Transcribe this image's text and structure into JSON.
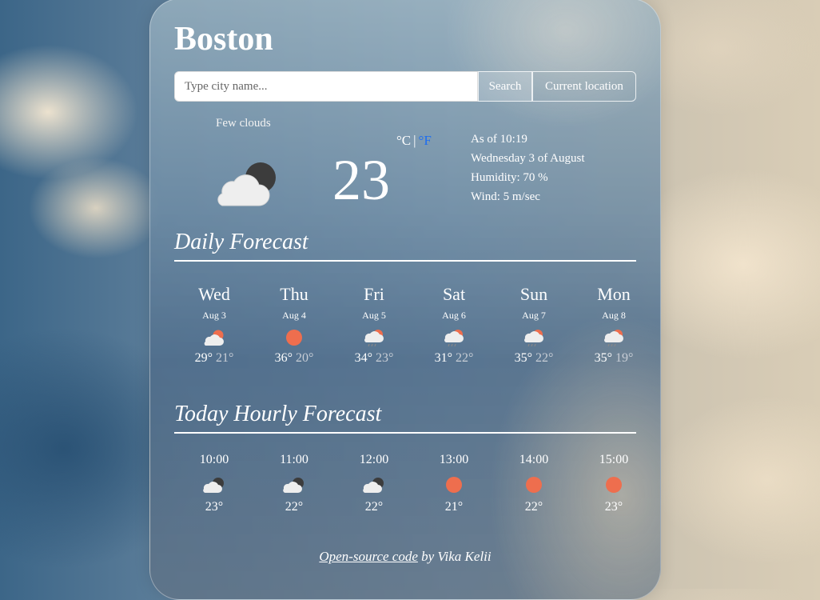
{
  "city": "Boston",
  "search": {
    "placeholder": "Type city name...",
    "search_label": "Search",
    "location_label": "Current location"
  },
  "current": {
    "description": "Few clouds",
    "icon": "few-clouds-night-icon",
    "temperature": "23",
    "unit_c": "°C",
    "unit_sep": "|",
    "unit_f": "°F",
    "as_of": "As of 10:19",
    "date": "Wednesday 3 of August",
    "humidity": "Humidity: 70 %",
    "wind": "Wind: 5 m/sec"
  },
  "daily_title": "Daily Forecast",
  "daily": [
    {
      "day": "Wed",
      "date": "Aug 3",
      "icon": "cloud-sun-icon",
      "high": "29°",
      "low": "21°"
    },
    {
      "day": "Thu",
      "date": "Aug 4",
      "icon": "sun-icon",
      "high": "36°",
      "low": "20°"
    },
    {
      "day": "Fri",
      "date": "Aug 5",
      "icon": "rain-sun-icon",
      "high": "34°",
      "low": "23°"
    },
    {
      "day": "Sat",
      "date": "Aug 6",
      "icon": "rain-sun-icon",
      "high": "31°",
      "low": "22°"
    },
    {
      "day": "Sun",
      "date": "Aug 7",
      "icon": "rain-sun-icon",
      "high": "35°",
      "low": "22°"
    },
    {
      "day": "Mon",
      "date": "Aug 8",
      "icon": "rain-sun-icon",
      "high": "35°",
      "low": "19°"
    }
  ],
  "hourly_title": "Today Hourly Forecast",
  "hourly": [
    {
      "time": "10:00",
      "icon": "cloud-moon-icon",
      "temp": "23°"
    },
    {
      "time": "11:00",
      "icon": "cloud-moon-icon",
      "temp": "22°"
    },
    {
      "time": "12:00",
      "icon": "cloud-moon-icon",
      "temp": "22°"
    },
    {
      "time": "13:00",
      "icon": "sun-icon",
      "temp": "21°"
    },
    {
      "time": "14:00",
      "icon": "sun-icon",
      "temp": "22°"
    },
    {
      "time": "15:00",
      "icon": "sun-icon",
      "temp": "23°"
    }
  ],
  "footer": {
    "link": "Open-source code",
    "by": " by Vika Kelii"
  },
  "colors": {
    "sun": "#ee6e4e",
    "unit_link": "#1e6ef0"
  }
}
